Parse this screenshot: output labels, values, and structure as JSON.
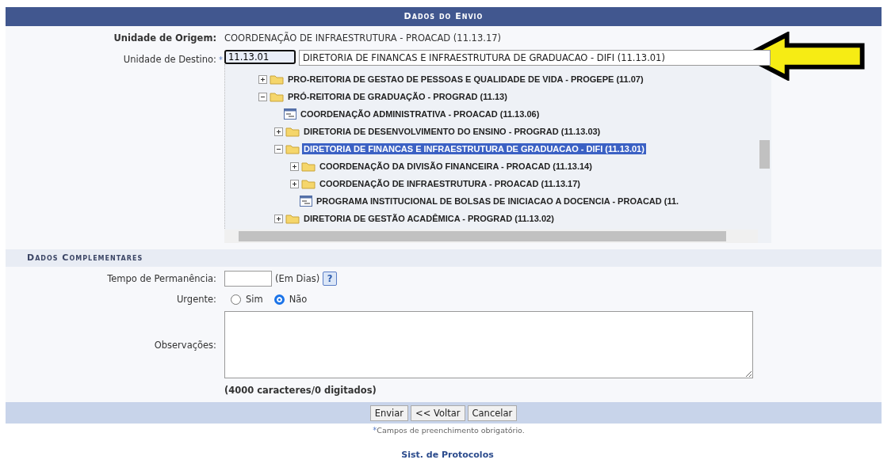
{
  "header": {
    "title": "Dados do Envio"
  },
  "origem": {
    "label": "Unidade de Origem:",
    "value": "COORDENAÇÃO DE INFRAESTRUTURA - PROACAD (11.13.17)"
  },
  "destino": {
    "label": "Unidade de Destino:",
    "required_mark": "*",
    "code": "11.13.01",
    "selected_text": "DIRETORIA DE FINANCAS E INFRAESTRUTURA DE GRADUACAO - DIFI (11.13.01)"
  },
  "tree": [
    {
      "label": "PRO-REITORIA DE GESTAO DE PESSOAS E QUALIDADE DE VIDA - PROGEPE (11.07)",
      "kind": "folder",
      "expanded": false,
      "selected": false
    },
    {
      "label": "PRÓ-REITORIA DE GRADUAÇÃO - PROGRAD (11.13)",
      "kind": "folder",
      "expanded": true,
      "selected": false,
      "children": [
        {
          "label": "COORDENAÇÃO ADMINISTRATIVA - PROACAD (11.13.06)",
          "kind": "unit",
          "selected": false
        },
        {
          "label": "DIRETORIA DE DESENVOLVIMENTO DO ENSINO - PROGRAD (11.13.03)",
          "kind": "folder",
          "expanded": false,
          "selected": false
        },
        {
          "label": "DIRETORIA DE FINANCAS E INFRAESTRUTURA DE GRADUACAO - DIFI (11.13.01)",
          "kind": "folder",
          "expanded": true,
          "selected": true,
          "children": [
            {
              "label": "COORDENAÇÃO DA DIVISÃO FINANCEIRA - PROACAD (11.13.14)",
              "kind": "folder",
              "expanded": false,
              "selected": false
            },
            {
              "label": "COORDENAÇÃO DE INFRAESTRUTURA - PROACAD (11.13.17)",
              "kind": "folder",
              "expanded": false,
              "selected": false
            },
            {
              "label": "PROGRAMA INSTITUCIONAL DE BOLSAS DE INICIACAO A DOCENCIA - PROACAD (11.",
              "kind": "unit",
              "selected": false
            }
          ]
        },
        {
          "label": "DIRETORIA DE GESTÃO ACADÊMICA - PROGRAD (11.13.02)",
          "kind": "folder",
          "expanded": false,
          "selected": false
        }
      ]
    }
  ],
  "complementares": {
    "title": "Dados Complementares",
    "tempo": {
      "label": "Tempo de Permanência:",
      "unit": "(Em Dias)",
      "help": "?"
    },
    "urgente": {
      "label": "Urgente:",
      "options": [
        {
          "label": "Sim",
          "selected": false
        },
        {
          "label": "Não",
          "selected": true
        }
      ]
    },
    "observacoes": {
      "label": "Observações:",
      "counter": "(4000 caracteres/0 digitados)"
    }
  },
  "buttons": [
    "Enviar",
    "<< Voltar",
    "Cancelar"
  ],
  "footnote": {
    "mark": "*",
    "text": "Campos de preenchimento obrigatório."
  },
  "footer_link": "Sist. de Protocolos"
}
